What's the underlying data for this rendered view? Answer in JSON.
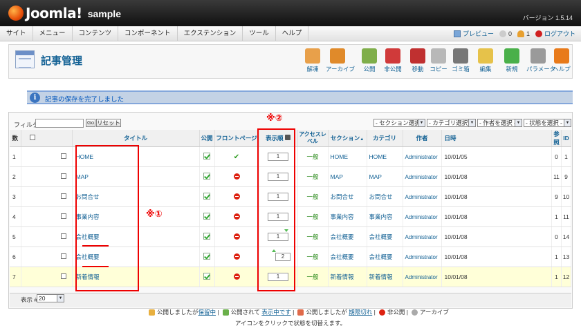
{
  "app": {
    "logo": "Joomla!",
    "site": "sample",
    "version": "バージョン 1.5.14"
  },
  "menu": [
    "サイト",
    "メニュー",
    "コンテンツ",
    "コンポーネント",
    "エクステンション",
    "ツール",
    "ヘルプ"
  ],
  "status": {
    "preview": "プレビュー",
    "messages": "0",
    "users": "1",
    "logout": "ログアウト"
  },
  "page_title": "記事管理",
  "toolbar": [
    {
      "label": "解凍",
      "icon": "unarchive-icon",
      "color": "#e8a04a"
    },
    {
      "label": "アーカイブ",
      "icon": "archive-icon",
      "color": "#e08a2a"
    },
    {
      "label": "公開",
      "icon": "publish-icon",
      "color": "#7fae4a"
    },
    {
      "label": "非公開",
      "icon": "unpublish-icon",
      "color": "#d03a3a"
    },
    {
      "label": "移動",
      "icon": "move-icon",
      "color": "#c03030"
    },
    {
      "label": "コピー",
      "icon": "copy-icon",
      "color": "#b8b8b8"
    },
    {
      "label": "ゴミ箱",
      "icon": "trash-icon",
      "color": "#777777"
    },
    {
      "label": "編集",
      "icon": "edit-icon",
      "color": "#e6c24a"
    },
    {
      "label": "新規",
      "icon": "new-icon",
      "color": "#4ab04a"
    },
    {
      "label": "パラメータ",
      "icon": "parameters-icon",
      "color": "#9a9a9a"
    },
    {
      "label": "ヘルプ",
      "icon": "help-icon",
      "color": "#e87a1a"
    }
  ],
  "message": "記事の保存を完了しました",
  "filter": {
    "label": "フィルタ:",
    "go": "Go",
    "reset": "リセット"
  },
  "selects": [
    "- セクション選択 -",
    "- カテゴリ選択 -",
    "- 作者を選択 -",
    "- 状態を選択 -"
  ],
  "columns": {
    "num": "数",
    "title": "タイトル",
    "published": "公開",
    "frontpage": "フロントページ",
    "order": "表示順",
    "access": "アクセスレベル",
    "section": "セクション",
    "category": "カテゴリ",
    "author": "作者",
    "date": "日時",
    "hits": "参照",
    "id": "ID"
  },
  "rows": [
    {
      "num": "1",
      "title": "HOME",
      "order": "1",
      "access": "一般",
      "section": "HOME",
      "category": "HOME",
      "author": "Administrator",
      "date": "10/01/05",
      "hits": "0",
      "id": "1",
      "frontpage": true
    },
    {
      "num": "2",
      "title": "MAP",
      "order": "1",
      "access": "一般",
      "section": "MAP",
      "category": "MAP",
      "author": "Administrator",
      "date": "10/01/08",
      "hits": "11",
      "id": "9",
      "frontpage": false
    },
    {
      "num": "3",
      "title": "お問合せ",
      "order": "1",
      "access": "一般",
      "section": "お問合せ",
      "category": "お問合せ",
      "author": "Administrator",
      "date": "10/01/08",
      "hits": "9",
      "id": "10",
      "frontpage": false
    },
    {
      "num": "4",
      "title": "事業内容",
      "order": "1",
      "access": "一般",
      "section": "事業内容",
      "category": "事業内容",
      "author": "Administrator",
      "date": "10/01/08",
      "hits": "1",
      "id": "11",
      "frontpage": false
    },
    {
      "num": "5",
      "title": "会社概要",
      "order": "1",
      "access": "一般",
      "section": "会社概要",
      "category": "会社概要",
      "author": "Administrator",
      "date": "10/01/08",
      "hits": "0",
      "id": "14",
      "frontpage": false
    },
    {
      "num": "6",
      "title": "会社概要",
      "order": "2",
      "access": "一般",
      "section": "会社概要",
      "category": "会社概要",
      "author": "Administrator",
      "date": "10/01/08",
      "hits": "1",
      "id": "13",
      "frontpage": false
    },
    {
      "num": "7",
      "title": "新着情報",
      "order": "1",
      "access": "一般",
      "section": "新着情報",
      "category": "新着情報",
      "author": "Administrator",
      "date": "10/01/08",
      "hits": "1",
      "id": "12",
      "frontpage": false
    }
  ],
  "display": {
    "label": "表示 #",
    "value": "20"
  },
  "legend": {
    "a": "公開しましたが",
    "a2": "保留中",
    "b": "公開されて",
    "b2": "表示中です",
    "c": "公開しましたが",
    "c2": "期限切れ",
    "d": "非公開",
    "e": "アーカイブ",
    "note": "アイコンをクリックで状態を切替えます。"
  },
  "annotations": {
    "one": "※①",
    "two": "※②"
  }
}
